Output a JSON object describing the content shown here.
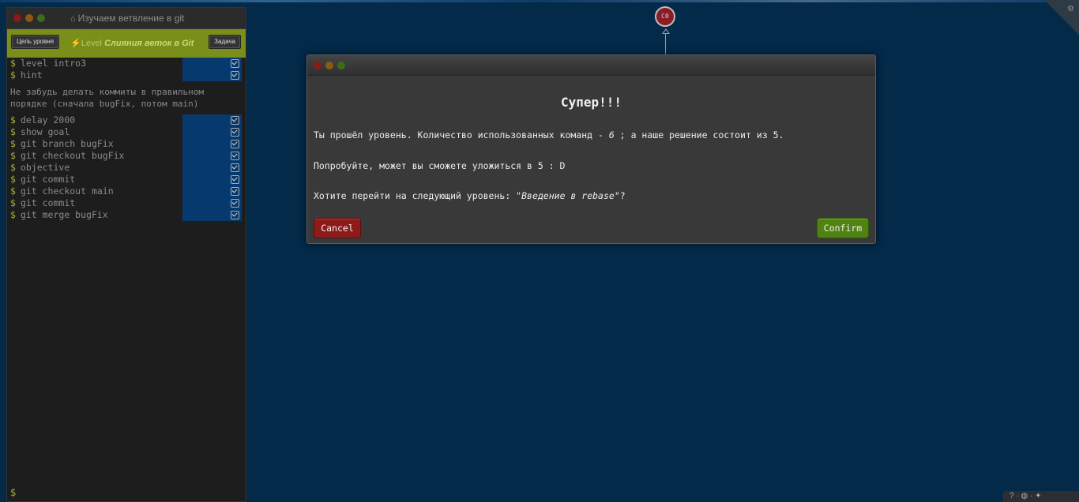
{
  "terminal": {
    "title": "Изучаем ветвление в git",
    "level_label": "Level",
    "level_name": "Слияния веток в Git",
    "goal_button": "Цель уровня",
    "task_button": "Задача",
    "commands_top": [
      "level intro3",
      "hint"
    ],
    "hint_text": "Не забудь делать коммиты в правильном порядке (сначала bugFix, потом main)",
    "commands": [
      "delay 2000",
      "show goal",
      "git branch bugFix",
      "git checkout bugFix",
      "objective",
      "git commit",
      "git checkout main",
      "git commit",
      "git merge bugFix"
    ],
    "prompt": "$"
  },
  "graph": {
    "commit_label": "C0"
  },
  "modal": {
    "title": "Супер!!!",
    "line1_prefix": "Ты прошёл уровень. Количество использованных команд - ",
    "line1_count": "6",
    "line1_suffix": " ; а наше решение состоит из 5.",
    "line2": "Попробуйте, может вы сможете уложиться в 5 : D",
    "line3_prefix": "Хотите перейти на следующий уровень: \"",
    "line3_level": "Введение в rebase",
    "line3_suffix": "\"?",
    "cancel_label": "Cancel",
    "confirm_label": "Confirm"
  },
  "colors": {
    "background": "#032a49",
    "level_bar": "#7a8f19",
    "cancel": "#8e1a1a",
    "confirm": "#4f8210",
    "commit_node": "#8a1c26"
  }
}
